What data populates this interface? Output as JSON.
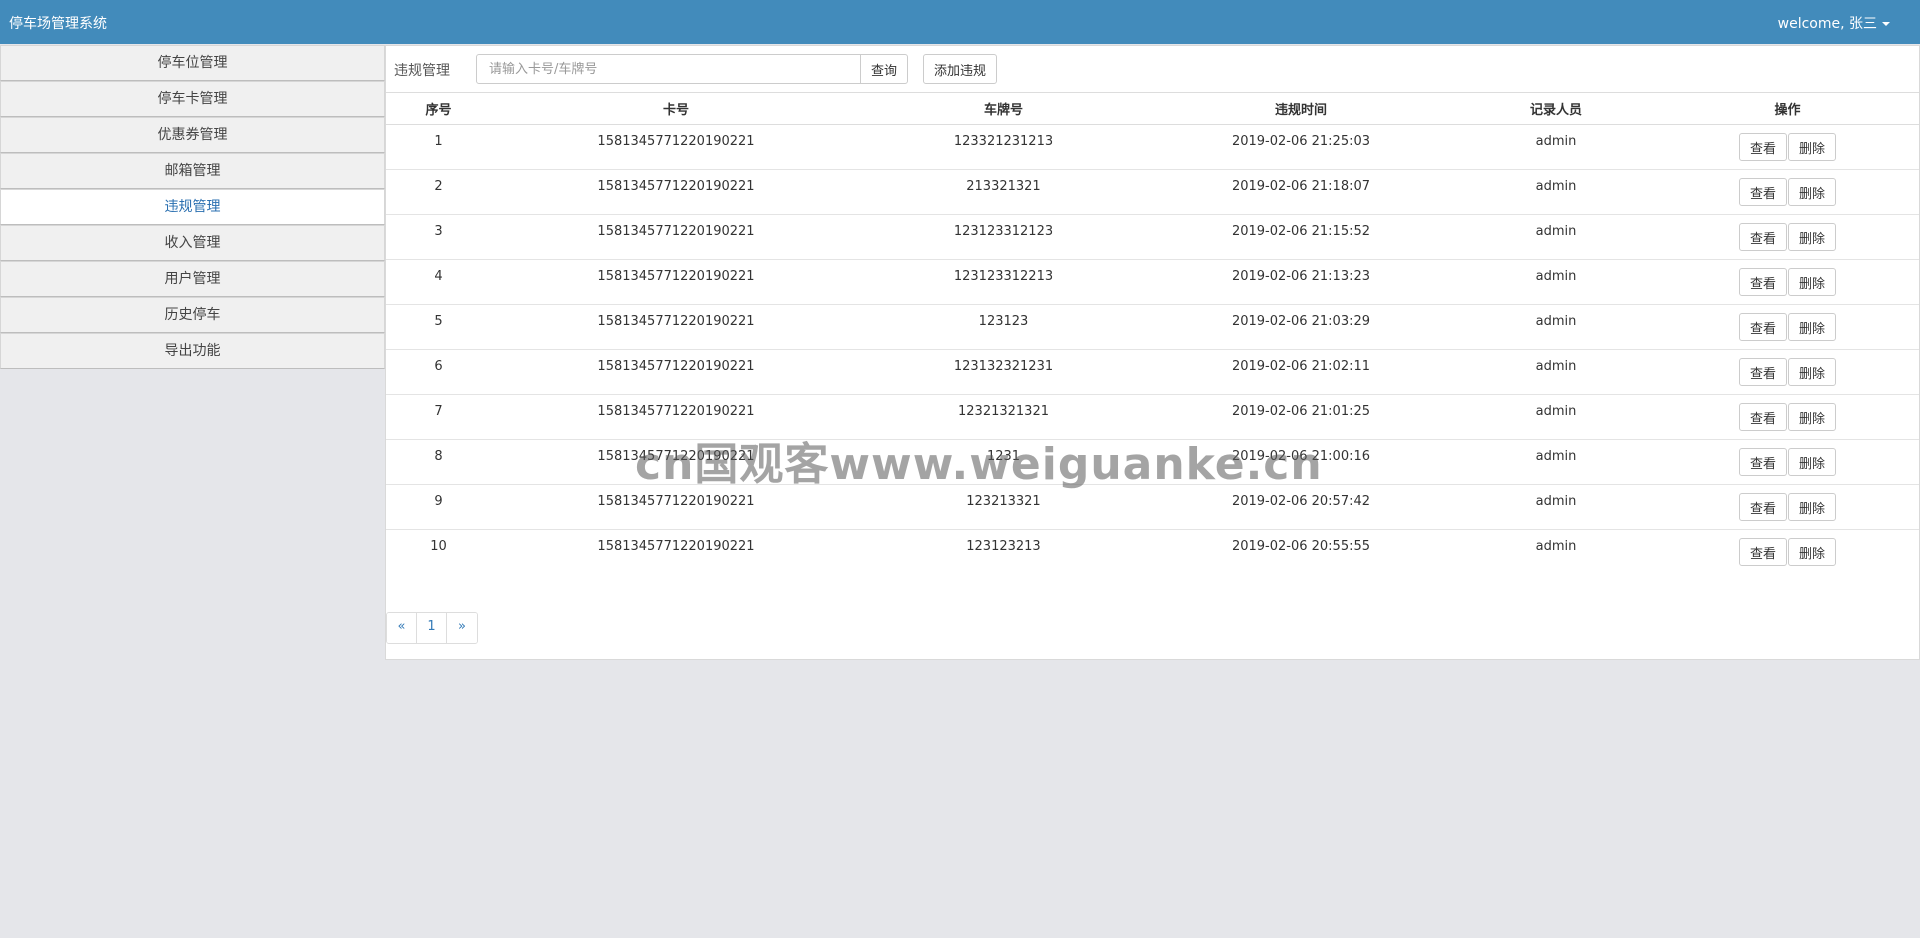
{
  "header": {
    "app_title": "停车场管理系统",
    "user_greeting": "welcome, 张三"
  },
  "sidebar": {
    "items": [
      {
        "label": "停车位管理",
        "active": false
      },
      {
        "label": "停车卡管理",
        "active": false
      },
      {
        "label": "优惠券管理",
        "active": false
      },
      {
        "label": "邮箱管理",
        "active": false
      },
      {
        "label": "违规管理",
        "active": true
      },
      {
        "label": "收入管理",
        "active": false
      },
      {
        "label": "用户管理",
        "active": false
      },
      {
        "label": "历史停车",
        "active": false
      },
      {
        "label": "导出功能",
        "active": false
      }
    ]
  },
  "toolbar": {
    "section_label": "违规管理",
    "search_placeholder": "请输入卡号/车牌号",
    "search_label": "查询",
    "add_label": "添加违规"
  },
  "table": {
    "columns": [
      "序号",
      "卡号",
      "车牌号",
      "违规时间",
      "记录人员",
      "操作"
    ],
    "view_label": "查看",
    "delete_label": "删除",
    "rows": [
      {
        "no": "1",
        "card": "1581345771220190221",
        "plate": "123321231213",
        "time": "2019-02-06 21:25:03",
        "recorder": "admin"
      },
      {
        "no": "2",
        "card": "1581345771220190221",
        "plate": "213321321",
        "time": "2019-02-06 21:18:07",
        "recorder": "admin"
      },
      {
        "no": "3",
        "card": "1581345771220190221",
        "plate": "123123312123",
        "time": "2019-02-06 21:15:52",
        "recorder": "admin"
      },
      {
        "no": "4",
        "card": "1581345771220190221",
        "plate": "123123312213",
        "time": "2019-02-06 21:13:23",
        "recorder": "admin"
      },
      {
        "no": "5",
        "card": "1581345771220190221",
        "plate": "123123",
        "time": "2019-02-06 21:03:29",
        "recorder": "admin"
      },
      {
        "no": "6",
        "card": "1581345771220190221",
        "plate": "123132321231",
        "time": "2019-02-06 21:02:11",
        "recorder": "admin"
      },
      {
        "no": "7",
        "card": "1581345771220190221",
        "plate": "12321321321",
        "time": "2019-02-06 21:01:25",
        "recorder": "admin"
      },
      {
        "no": "8",
        "card": "1581345771220190221",
        "plate": "1231",
        "time": "2019-02-06 21:00:16",
        "recorder": "admin"
      },
      {
        "no": "9",
        "card": "1581345771220190221",
        "plate": "123213321",
        "time": "2019-02-06 20:57:42",
        "recorder": "admin"
      },
      {
        "no": "10",
        "card": "1581345771220190221",
        "plate": "123123213",
        "time": "2019-02-06 20:55:55",
        "recorder": "admin"
      }
    ]
  },
  "pagination": {
    "prev": "«",
    "pages": [
      "1"
    ],
    "next": "»"
  },
  "watermark": "cn国观客www.weiguanke.cn"
}
